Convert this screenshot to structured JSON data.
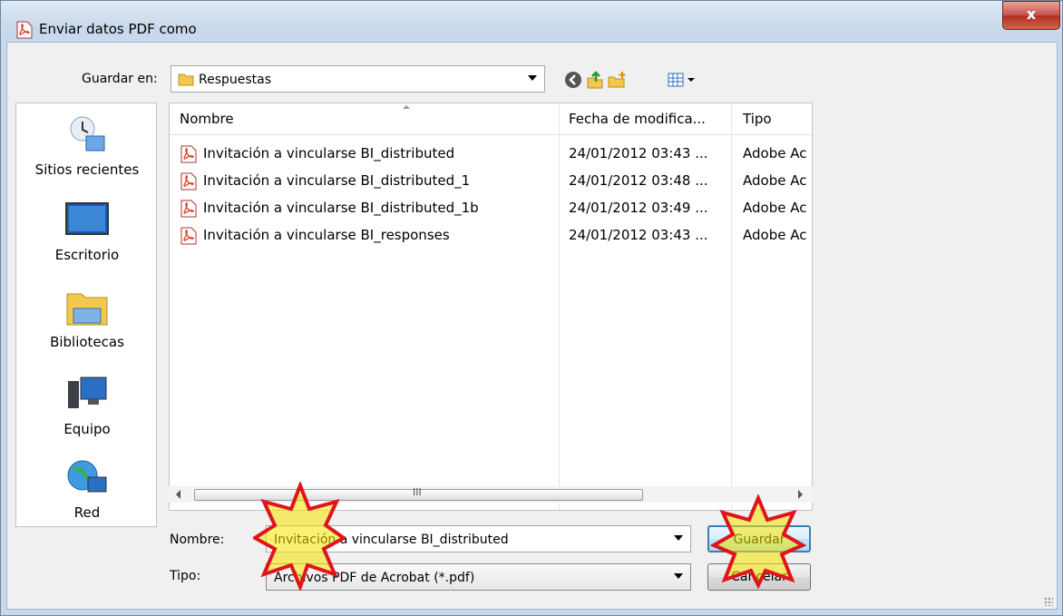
{
  "window": {
    "title": "Enviar datos PDF como",
    "close_label": "x"
  },
  "toolbar": {
    "save_in_label": "Guardar en:",
    "save_in_value": "Respuestas",
    "icons": [
      "back-icon",
      "up-folder-icon",
      "new-folder-icon",
      "view-menu-icon"
    ]
  },
  "places": [
    {
      "label": "Sitios recientes",
      "icon": "recent-places-icon"
    },
    {
      "label": "Escritorio",
      "icon": "desktop-icon"
    },
    {
      "label": "Bibliotecas",
      "icon": "libraries-icon"
    },
    {
      "label": "Equipo",
      "icon": "computer-icon"
    },
    {
      "label": "Red",
      "icon": "network-icon"
    }
  ],
  "filelist": {
    "columns": [
      "Nombre",
      "Fecha de modifica...",
      "Tipo"
    ],
    "rows": [
      {
        "name": "Invitación a vincularse BI_distributed",
        "date": "24/01/2012 03:43 ...",
        "type": "Adobe Ac"
      },
      {
        "name": "Invitación a vincularse BI_distributed_1",
        "date": "24/01/2012 03:48 ...",
        "type": "Adobe Ac"
      },
      {
        "name": "Invitación a vincularse BI_distributed_1b",
        "date": "24/01/2012 03:49 ...",
        "type": "Adobe Ac"
      },
      {
        "name": "Invitación a vincularse BI_responses",
        "date": "24/01/2012 03:43 ...",
        "type": "Adobe Ac"
      }
    ],
    "scroll_grip": "III"
  },
  "form": {
    "name_label": "Nombre:",
    "name_value": "Invitación a vincularse BI_distributed",
    "type_label": "Tipo:",
    "type_value": "Archivos PDF de Acrobat (*.pdf)"
  },
  "buttons": {
    "save": "Guardar",
    "cancel": "Cancelar"
  },
  "colors": {
    "highlight_star_fill": "#f5e600",
    "highlight_star_stroke": "#e0141c",
    "default_button_border": "#3c7fb1"
  }
}
